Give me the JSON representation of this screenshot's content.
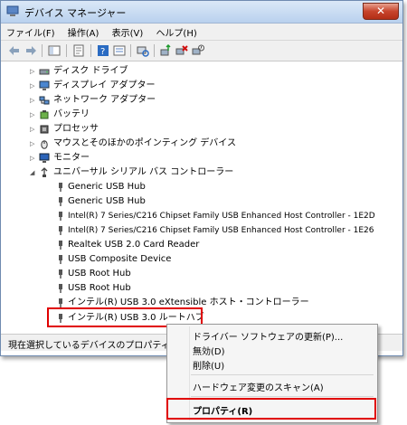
{
  "window": {
    "title": "デバイス マネージャー",
    "close_glyph": "✕"
  },
  "menu": [
    "ファイル(F)",
    "操作(A)",
    "表示(V)",
    "ヘルプ(H)"
  ],
  "tree": {
    "categories": [
      {
        "label": "ディスク ドライブ",
        "icon": "disk-drive-icon"
      },
      {
        "label": "ディスプレイ アダプター",
        "icon": "display-adapter-icon"
      },
      {
        "label": "ネットワーク アダプター",
        "icon": "network-adapter-icon"
      },
      {
        "label": "バッテリ",
        "icon": "battery-icon"
      },
      {
        "label": "プロセッサ",
        "icon": "processor-icon"
      },
      {
        "label": "マウスとそのほかのポインティング デバイス",
        "icon": "mouse-icon"
      },
      {
        "label": "モニター",
        "icon": "monitor-icon"
      },
      {
        "label": "ユニバーサル シリアル バス コントローラー",
        "icon": "usb-controller-icon"
      }
    ],
    "usb_children": [
      "Generic USB Hub",
      "Generic USB Hub",
      "Intel(R) 7 Series/C216 Chipset Family USB Enhanced Host Controller - 1E2D",
      "Intel(R) 7 Series/C216 Chipset Family USB Enhanced Host Controller - 1E26",
      "Realtek USB 2.0 Card Reader",
      "USB Composite Device",
      "USB Root Hub",
      "USB Root Hub",
      "インテル(R) USB 3.0 eXtensible ホスト・コントローラー",
      "インテル(R) USB 3.0 ルートハブ"
    ]
  },
  "status_bar": "現在選択しているデバイスのプロパティ",
  "context_menu": {
    "update_driver": "ドライバー ソフトウェアの更新(P)...",
    "disable": "無効(D)",
    "uninstall": "削除(U)",
    "scan": "ハードウェア変更のスキャン(A)",
    "properties": "プロパティ(R)"
  },
  "colors": {
    "highlight_border": "#e00000",
    "title_bar": "#c4d8f0"
  }
}
